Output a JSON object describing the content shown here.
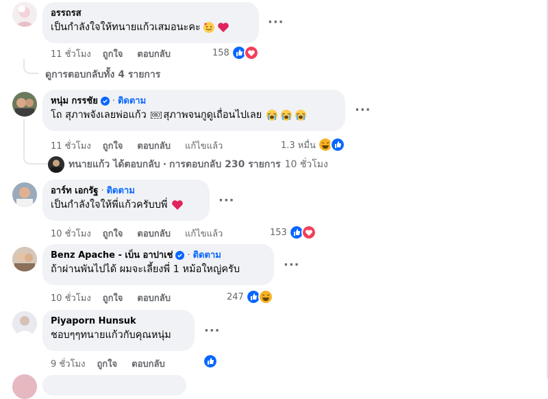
{
  "comments": [
    {
      "author": "อรรถรส",
      "text": "เป็นกำลังใจให้ทนายแก้วเสมอนะคะ",
      "emojis": [
        "smiling-face-with-hearts-icon",
        "heart-icon"
      ],
      "time": "11 ชั่วโมง",
      "like_label": "ถูกใจ",
      "reply_label": "ตอบกลับ",
      "reaction_count": "158",
      "reactions": [
        "like",
        "love"
      ]
    },
    {
      "author": "หนุ่ม กรรชัย",
      "verified": true,
      "follow_label": "ติดตาม",
      "text_before": "โถ สุภาพจังเลยพ่อแก้ว",
      "glyph_box": "OBJ",
      "text_after": "สุภาพจนกูดูเถื่อนไปเลย",
      "emojis": [
        "loudly-crying-face-icon",
        "loudly-crying-face-icon",
        "loudly-crying-face-icon"
      ],
      "time": "11 ชั่วโมง",
      "like_label": "ถูกใจ",
      "reply_label": "ตอบกลับ",
      "edited_label": "แก้ไขแล้ว",
      "reaction_count": "1.3 หมื่น",
      "reactions": [
        "haha",
        "like"
      ]
    },
    {
      "author": "อาร์ท เอกรัฐ",
      "follow_label": "ติดตาม",
      "text": "เป็นกำลังใจให้พี่แก้วครับบพี่",
      "emojis": [
        "heart-icon"
      ],
      "time": "10 ชั่วโมง",
      "like_label": "ถูกใจ",
      "reply_label": "ตอบกลับ",
      "edited_label": "แก้ไขแล้ว",
      "reaction_count": "153",
      "reactions": [
        "like",
        "love"
      ]
    },
    {
      "author": "Benz Apache - เบ็น อาปาเช่",
      "verified": true,
      "follow_label": "ติดตาม",
      "text": "ถ้าผ่านพันไปได้ ผมจะเลี้ยงพี่ 1 หม้อใหญ่ครับ",
      "time": "10 ชั่วโมง",
      "like_label": "ถูกใจ",
      "reply_label": "ตอบกลับ",
      "reaction_count": "247",
      "reactions": [
        "like",
        "haha"
      ]
    },
    {
      "author": "Piyaporn Hunsuk",
      "text": "ชอบๆๆทนายแก้วกับคุณหนุ่ม",
      "time": "9 ชั่วโมง",
      "like_label": "ถูกใจ",
      "reply_label": "ตอบกลับ",
      "reactions": [
        "like"
      ]
    }
  ],
  "view_replies": "ดูการตอบกลับทั้ง 4 รายการ",
  "reply_summary": {
    "name": "ทนายแก้ว",
    "action": "ได้ตอบกลับ",
    "separator": "·",
    "count": "การตอบกลับ 230 รายการ",
    "time": "10 ชั่วโมง"
  },
  "more_label": "···",
  "colors": {
    "bubble": "#f0f2f5",
    "link": "#0866ff",
    "muted": "#65676b",
    "like": "#0866ff",
    "love": "#f33e58"
  }
}
